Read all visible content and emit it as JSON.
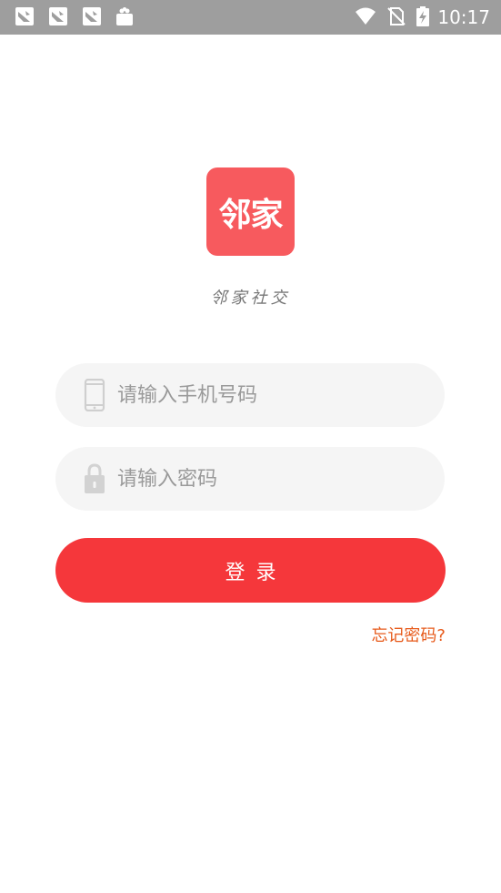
{
  "status_bar": {
    "time": "10:17",
    "notification_icons": [
      "bird-notification-icon",
      "bird-notification-icon",
      "bird-notification-icon",
      "shopping-bag-icon"
    ],
    "system_icons": [
      "wifi-icon",
      "no-sim-icon",
      "battery-charging-icon"
    ],
    "background_color": "#9e9e9e"
  },
  "app": {
    "logo_text": "邻家",
    "slogan": "邻家社交",
    "logo_color": "#f75a5e"
  },
  "form": {
    "phone_placeholder": "请输入手机号码",
    "phone_value": "",
    "password_placeholder": "请输入密码",
    "password_value": "",
    "login_label": "登录",
    "forgot_label": "忘记密码?",
    "login_color": "#f5373b",
    "forgot_color": "#e75a1b"
  }
}
